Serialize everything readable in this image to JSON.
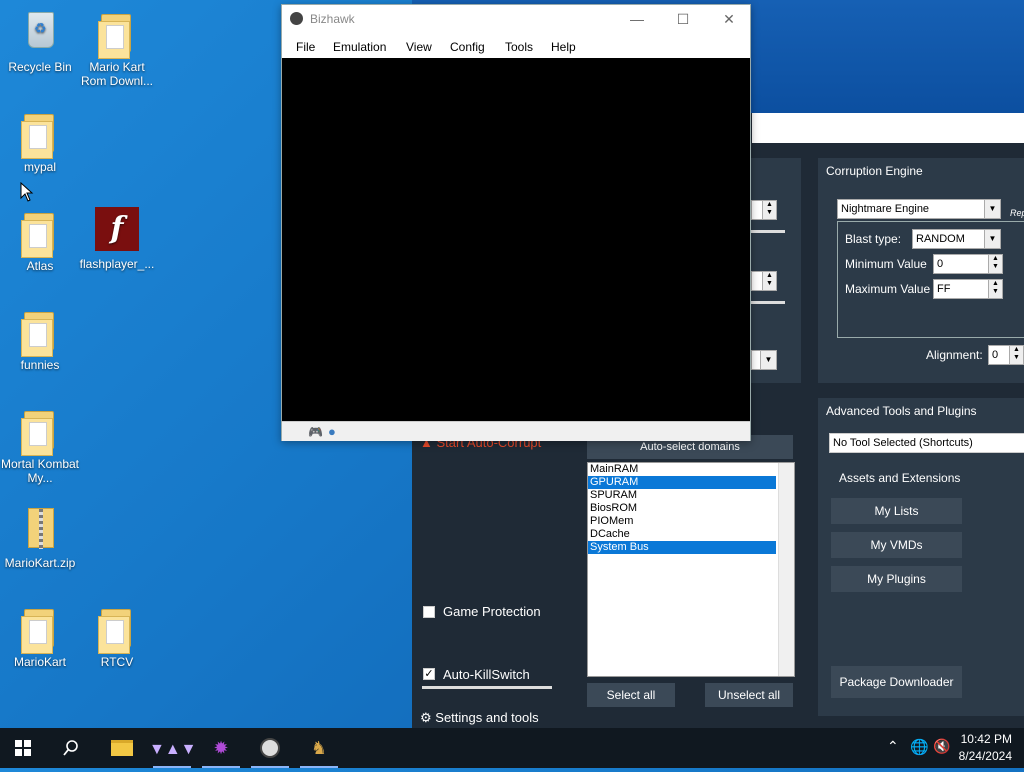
{
  "desktop": {
    "icons": [
      {
        "label": "Recycle Bin",
        "icon": "recycle-bin-icon"
      },
      {
        "label": "Mario Kart Rom Downl...",
        "icon": "installer-icon"
      },
      {
        "label": "mypal",
        "icon": "folder-icon"
      },
      {
        "label": "Atlas",
        "icon": "folder-icon"
      },
      {
        "label": "flashplayer_...",
        "icon": "flash-icon"
      },
      {
        "label": "funnies",
        "icon": "folder-icon"
      },
      {
        "label": "Mortal Kombat My...",
        "icon": "folder-icon"
      },
      {
        "label": "MarioKart.zip",
        "icon": "zip-icon"
      },
      {
        "label": "MarioKart",
        "icon": "folder-icon"
      },
      {
        "label": "RTCV",
        "icon": "folder-icon"
      }
    ]
  },
  "bizhawk": {
    "title": "Bizhawk",
    "menu": [
      "File",
      "Emulation",
      "View",
      "Config",
      "Tools",
      "Help"
    ],
    "controls": {
      "minimize": "—",
      "maximize": "☐",
      "close": "✕"
    }
  },
  "rtc": {
    "corruption_engine": {
      "title": "Corruption Engine",
      "engine": "Nightmare Engine",
      "blast_type_label": "Blast type:",
      "blast_type": "RANDOM",
      "min_label": "Minimum Value",
      "min_value": "0",
      "max_label": "Maximum Value",
      "max_value": "FF",
      "alignment_label": "Alignment:",
      "alignment_value": "0",
      "cut_label": "Rep"
    },
    "advanced": {
      "title": "Advanced Tools and Plugins",
      "tool_select": "No Tool Selected (Shortcuts)",
      "assets_title": "Assets and Extensions",
      "buttons": [
        "My Lists",
        "My VMDs",
        "My Plugins"
      ],
      "package_downloader": "Package Downloader"
    },
    "domains": {
      "auto_select": "Auto-select domains",
      "items": [
        {
          "label": "MainRAM",
          "selected": false
        },
        {
          "label": "GPURAM",
          "selected": true
        },
        {
          "label": "SPURAM",
          "selected": false
        },
        {
          "label": "BiosROM",
          "selected": false
        },
        {
          "label": "PIOMem",
          "selected": false
        },
        {
          "label": "DCache",
          "selected": false
        },
        {
          "label": "System Bus",
          "selected": true
        }
      ],
      "select_all": "Select all",
      "unselect_all": "Unselect all"
    },
    "left": {
      "start_auto_corrupt": "Start Auto-Corrupt",
      "game_protection": "Game Protection",
      "auto_killswitch": "Auto-KillSwitch",
      "settings": "Settings and tools"
    }
  },
  "taskbar": {
    "time": "10:42 PM",
    "date": "8/24/2024"
  }
}
